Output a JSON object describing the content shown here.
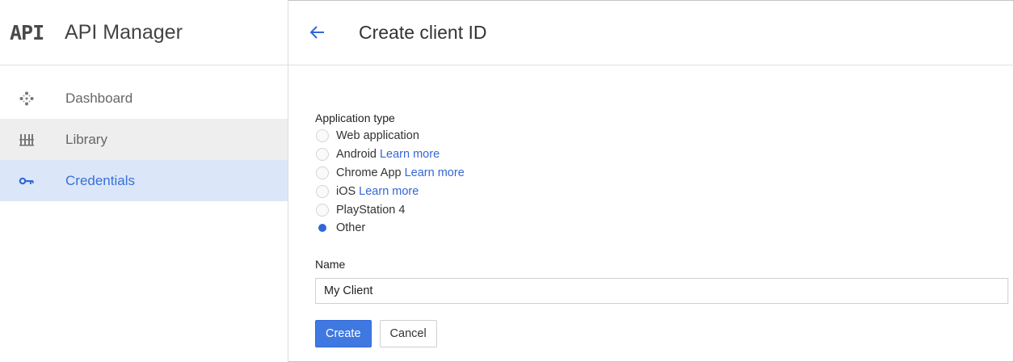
{
  "brand": {
    "logo_text": "API",
    "title": "API Manager"
  },
  "sidebar": {
    "items": [
      {
        "label": "Dashboard",
        "icon": "dashboard-icon",
        "state": "normal"
      },
      {
        "label": "Library",
        "icon": "library-icon",
        "state": "hover"
      },
      {
        "label": "Credentials",
        "icon": "key-icon",
        "state": "active"
      }
    ]
  },
  "header": {
    "title": "Create client ID",
    "back_icon": "back-arrow-icon"
  },
  "form": {
    "app_type_label": "Application type",
    "options": [
      {
        "label": "Web application",
        "link": null,
        "checked": false
      },
      {
        "label": "Android",
        "link": "Learn more",
        "checked": false
      },
      {
        "label": "Chrome App",
        "link": "Learn more",
        "checked": false
      },
      {
        "label": "iOS",
        "link": "Learn more",
        "checked": false
      },
      {
        "label": "PlayStation 4",
        "link": null,
        "checked": false
      },
      {
        "label": "Other",
        "link": null,
        "checked": true
      }
    ],
    "name_label": "Name",
    "name_value": "My Client",
    "create_label": "Create",
    "cancel_label": "Cancel"
  },
  "colors": {
    "accent": "#3367d6",
    "active_bg": "#dbe7f8",
    "hover_bg": "#eeeeee"
  }
}
